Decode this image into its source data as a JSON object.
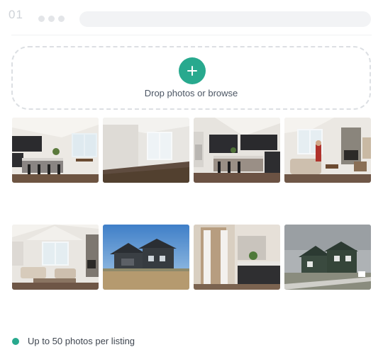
{
  "header": {
    "step_number": "01"
  },
  "dropzone": {
    "label": "Drop photos or browse",
    "add_icon": "plus-icon"
  },
  "photos": [
    {
      "name": "kitchen-island-photo",
      "theme": "kitchen"
    },
    {
      "name": "empty-living-room-photo",
      "theme": "empty-room"
    },
    {
      "name": "kitchen-pantry-photo",
      "theme": "kitchen2"
    },
    {
      "name": "living-room-fireplace-photo",
      "theme": "living-person"
    },
    {
      "name": "great-room-photo",
      "theme": "living"
    },
    {
      "name": "house-rear-exterior-photo",
      "theme": "exterior-blue"
    },
    {
      "name": "bathroom-vanity-photo",
      "theme": "bathroom"
    },
    {
      "name": "house-front-exterior-photo",
      "theme": "exterior-gray"
    }
  ],
  "footer": {
    "note": "Up to 50 photos per listing"
  },
  "colors": {
    "accent": "#28a98e",
    "dropzone_border": "#dcdfe3"
  }
}
